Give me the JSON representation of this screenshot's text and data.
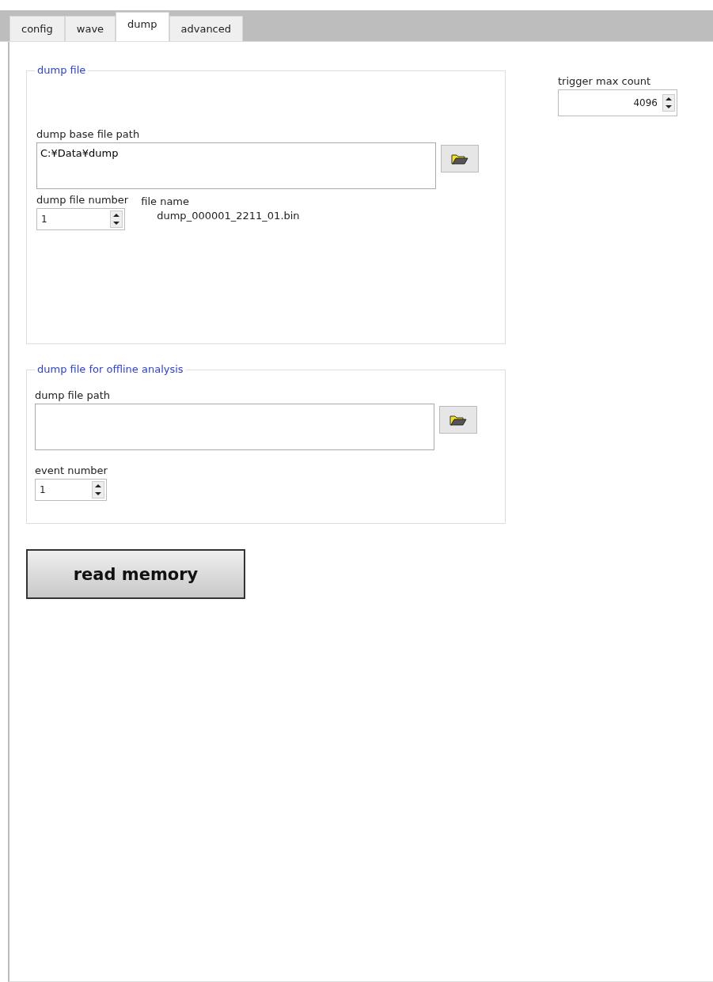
{
  "tabs": [
    {
      "label": "config",
      "selected": false
    },
    {
      "label": "wave",
      "selected": false
    },
    {
      "label": "dump",
      "selected": true
    },
    {
      "label": "advanced",
      "selected": false
    }
  ],
  "dump_file": {
    "title": "dump file",
    "base_path": {
      "label": "dump base file path",
      "value": "C:¥Data¥dump"
    },
    "file_number": {
      "label": "dump file number",
      "value": "1"
    },
    "file_name": {
      "label": "file name",
      "value": "dump_000001_2211_01.bin"
    }
  },
  "offline": {
    "title": "dump file for offline analysis",
    "path": {
      "label": "dump file path"
    },
    "event_number": {
      "label": "event number",
      "value": "1"
    }
  },
  "read_button": "read memory",
  "trigger_max_count": {
    "label": "trigger max count",
    "value": "4096"
  }
}
